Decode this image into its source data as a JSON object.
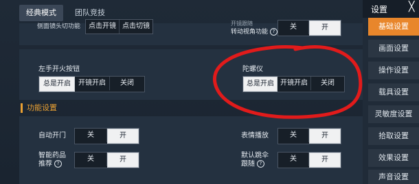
{
  "tabs": [
    {
      "label": "经典模式",
      "active": true
    },
    {
      "label": "团队竞技",
      "active": false
    }
  ],
  "sidebar": {
    "title": "设置",
    "close_glyph": "╳",
    "items": [
      {
        "label": "基础设置",
        "active": true
      },
      {
        "label": "画面设置",
        "active": false
      },
      {
        "label": "操作设置",
        "active": false
      },
      {
        "label": "载具设置",
        "active": false
      },
      {
        "label": "灵敏度设置",
        "active": false
      },
      {
        "label": "拾取设置",
        "active": false
      },
      {
        "label": "效果设置",
        "active": false
      },
      {
        "label": "声音设置",
        "active": false
      }
    ]
  },
  "top_partial": {
    "left_label": "侧面镜头切功能",
    "left_options": [
      "点击开镜",
      "点击切镜"
    ],
    "right_label_line1": "开镜跟随",
    "right_label_line2": "转动视角功能",
    "right_options": [
      "关",
      "开"
    ]
  },
  "fire_section": {
    "left_fire": {
      "label": "左手开火按钮",
      "options": [
        "总是开启",
        "开镜开启",
        "关闭"
      ],
      "selected": 0
    },
    "gyro": {
      "label": "陀螺仪",
      "options": [
        "总是开启",
        "开镜开启",
        "关闭"
      ],
      "selected": 0
    }
  },
  "function_section": {
    "title": "功能设置",
    "auto_door": {
      "label": "自动开门",
      "options": [
        "关",
        "开"
      ],
      "selected": 1
    },
    "emote": {
      "label": "表情播放",
      "options": [
        "关",
        "开"
      ],
      "selected": 1
    },
    "smart_medkit": {
      "label_line1": "智能药品",
      "label_line2": "推荐",
      "options": [
        "关",
        "开"
      ],
      "selected": 1
    },
    "auto_parachute": {
      "label_line1": "默认跳伞",
      "label_line2": "跟随",
      "options": [
        "关",
        "开"
      ],
      "selected": 1
    }
  },
  "colors": {
    "accent": "#e8862b",
    "section_title": "#e9a033",
    "annotation": "#e11b1b"
  }
}
